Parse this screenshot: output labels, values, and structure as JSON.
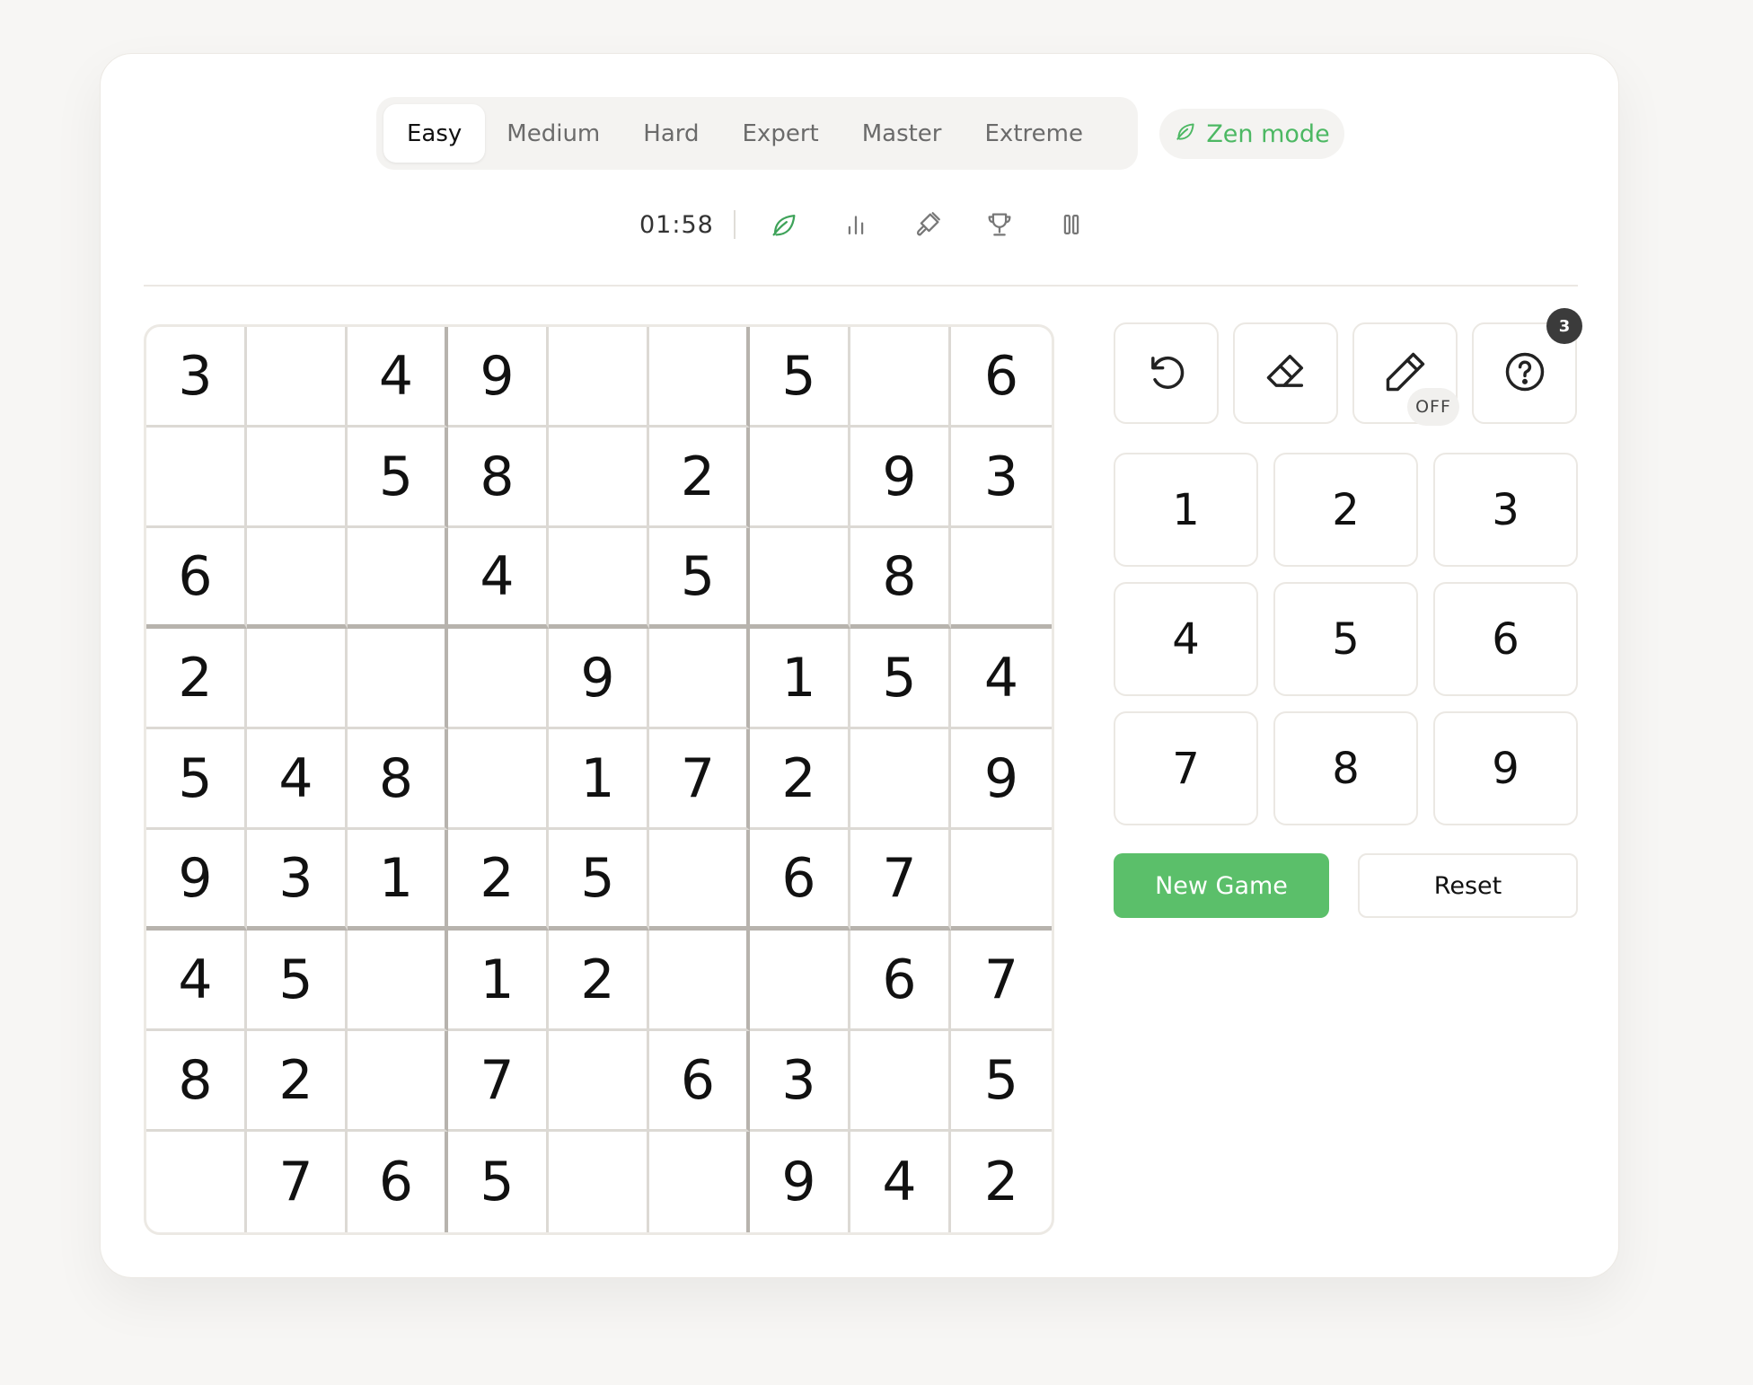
{
  "difficulty": {
    "tabs": [
      {
        "label": "Easy",
        "active": true
      },
      {
        "label": "Medium",
        "active": false
      },
      {
        "label": "Hard",
        "active": false
      },
      {
        "label": "Expert",
        "active": false
      },
      {
        "label": "Master",
        "active": false
      },
      {
        "label": "Extreme",
        "active": false
      }
    ]
  },
  "zen": {
    "label": "Zen mode",
    "icon": "leaf-icon",
    "color": "#4cb863"
  },
  "toolbar": {
    "timer": "01:58",
    "icons": [
      "leaf-icon",
      "stats-icon",
      "paint-brush-icon",
      "trophy-icon",
      "pause-icon"
    ]
  },
  "board": {
    "rows": [
      [
        "3",
        "",
        "4",
        "9",
        "",
        "",
        "5",
        "",
        "6"
      ],
      [
        "",
        "",
        "5",
        "8",
        "",
        "2",
        "",
        "9",
        "3"
      ],
      [
        "6",
        "",
        "",
        "4",
        "",
        "5",
        "",
        "8",
        ""
      ],
      [
        "2",
        "",
        "",
        "",
        "9",
        "",
        "1",
        "5",
        "4"
      ],
      [
        "5",
        "4",
        "8",
        "",
        "1",
        "7",
        "2",
        "",
        "9"
      ],
      [
        "9",
        "3",
        "1",
        "2",
        "5",
        "",
        "6",
        "7",
        ""
      ],
      [
        "4",
        "5",
        "",
        "1",
        "2",
        "",
        "",
        "6",
        "7"
      ],
      [
        "8",
        "2",
        "",
        "7",
        "",
        "6",
        "3",
        "",
        "5"
      ],
      [
        "",
        "7",
        "6",
        "5",
        "",
        "",
        "9",
        "4",
        "2"
      ]
    ]
  },
  "actions": {
    "undo": {
      "icon": "undo-icon"
    },
    "erase": {
      "icon": "eraser-icon"
    },
    "notes": {
      "icon": "pencil-icon",
      "state": "OFF"
    },
    "hint": {
      "icon": "question-icon",
      "count": "3"
    }
  },
  "numpad": [
    "1",
    "2",
    "3",
    "4",
    "5",
    "6",
    "7",
    "8",
    "9"
  ],
  "buttons": {
    "new_game": "New Game",
    "reset": "Reset",
    "accent": "#5bbf6a"
  }
}
